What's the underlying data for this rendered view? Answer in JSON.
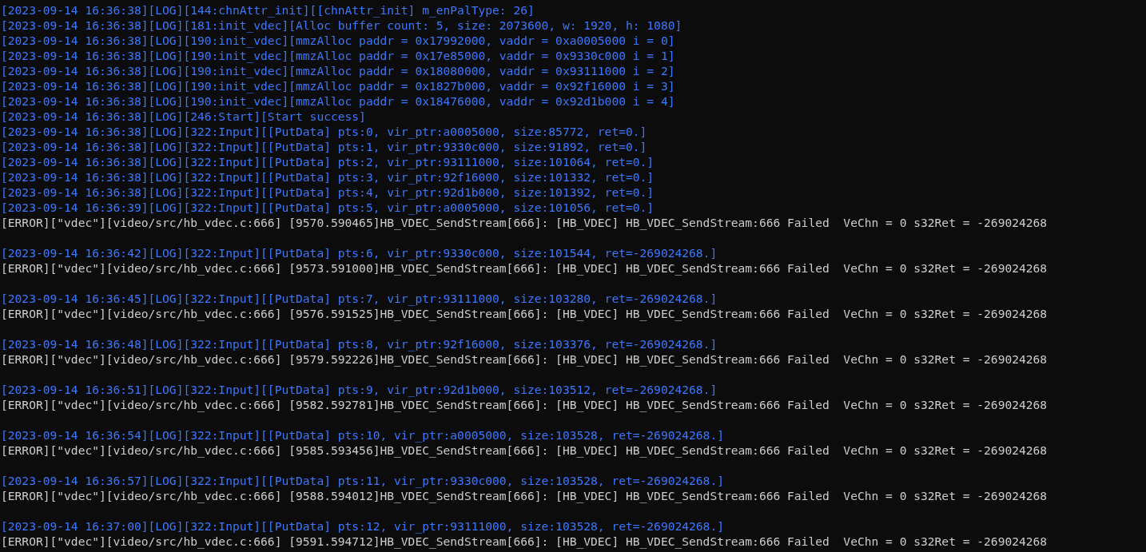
{
  "lines": [
    {
      "kind": "log",
      "text": "[2023-09-14 16:36:38][LOG][144:chnAttr_init][[chnAttr_init] m_enPalType: 26]"
    },
    {
      "kind": "log",
      "text": "[2023-09-14 16:36:38][LOG][181:init_vdec][Alloc buffer count: 5, size: 2073600, w: 1920, h: 1080]"
    },
    {
      "kind": "log",
      "text": "[2023-09-14 16:36:38][LOG][190:init_vdec][mmzAlloc paddr = 0x17992000, vaddr = 0xa0005000 i = 0]"
    },
    {
      "kind": "log",
      "text": "[2023-09-14 16:36:38][LOG][190:init_vdec][mmzAlloc paddr = 0x17e85000, vaddr = 0x9330c000 i = 1]"
    },
    {
      "kind": "log",
      "text": "[2023-09-14 16:36:38][LOG][190:init_vdec][mmzAlloc paddr = 0x18080000, vaddr = 0x93111000 i = 2]"
    },
    {
      "kind": "log",
      "text": "[2023-09-14 16:36:38][LOG][190:init_vdec][mmzAlloc paddr = 0x1827b000, vaddr = 0x92f16000 i = 3]"
    },
    {
      "kind": "log",
      "text": "[2023-09-14 16:36:38][LOG][190:init_vdec][mmzAlloc paddr = 0x18476000, vaddr = 0x92d1b000 i = 4]"
    },
    {
      "kind": "log",
      "text": "[2023-09-14 16:36:38][LOG][246:Start][Start success]"
    },
    {
      "kind": "log",
      "text": "[2023-09-14 16:36:38][LOG][322:Input][[PutData] pts:0, vir_ptr:a0005000, size:85772, ret=0.]"
    },
    {
      "kind": "log",
      "text": "[2023-09-14 16:36:38][LOG][322:Input][[PutData] pts:1, vir_ptr:9330c000, size:91892, ret=0.]"
    },
    {
      "kind": "log",
      "text": "[2023-09-14 16:36:38][LOG][322:Input][[PutData] pts:2, vir_ptr:93111000, size:101064, ret=0.]"
    },
    {
      "kind": "log",
      "text": "[2023-09-14 16:36:38][LOG][322:Input][[PutData] pts:3, vir_ptr:92f16000, size:101332, ret=0.]"
    },
    {
      "kind": "log",
      "text": "[2023-09-14 16:36:38][LOG][322:Input][[PutData] pts:4, vir_ptr:92d1b000, size:101392, ret=0.]"
    },
    {
      "kind": "log",
      "text": "[2023-09-14 16:36:39][LOG][322:Input][[PutData] pts:5, vir_ptr:a0005000, size:101056, ret=0.]"
    },
    {
      "kind": "error",
      "text": "[ERROR][\"vdec\"][video/src/hb_vdec.c:666] [9570.590465]HB_VDEC_SendStream[666]: [HB_VDEC] HB_VDEC_SendStream:666 Failed  VeChn = 0 s32Ret = -269024268"
    },
    {
      "kind": "blank"
    },
    {
      "kind": "log",
      "text": "[2023-09-14 16:36:42][LOG][322:Input][[PutData] pts:6, vir_ptr:9330c000, size:101544, ret=-269024268.]"
    },
    {
      "kind": "error",
      "text": "[ERROR][\"vdec\"][video/src/hb_vdec.c:666] [9573.591000]HB_VDEC_SendStream[666]: [HB_VDEC] HB_VDEC_SendStream:666 Failed  VeChn = 0 s32Ret = -269024268"
    },
    {
      "kind": "blank"
    },
    {
      "kind": "log",
      "text": "[2023-09-14 16:36:45][LOG][322:Input][[PutData] pts:7, vir_ptr:93111000, size:103280, ret=-269024268.]"
    },
    {
      "kind": "error",
      "text": "[ERROR][\"vdec\"][video/src/hb_vdec.c:666] [9576.591525]HB_VDEC_SendStream[666]: [HB_VDEC] HB_VDEC_SendStream:666 Failed  VeChn = 0 s32Ret = -269024268"
    },
    {
      "kind": "blank"
    },
    {
      "kind": "log",
      "text": "[2023-09-14 16:36:48][LOG][322:Input][[PutData] pts:8, vir_ptr:92f16000, size:103376, ret=-269024268.]"
    },
    {
      "kind": "error",
      "text": "[ERROR][\"vdec\"][video/src/hb_vdec.c:666] [9579.592226]HB_VDEC_SendStream[666]: [HB_VDEC] HB_VDEC_SendStream:666 Failed  VeChn = 0 s32Ret = -269024268"
    },
    {
      "kind": "blank"
    },
    {
      "kind": "log",
      "text": "[2023-09-14 16:36:51][LOG][322:Input][[PutData] pts:9, vir_ptr:92d1b000, size:103512, ret=-269024268.]"
    },
    {
      "kind": "error",
      "text": "[ERROR][\"vdec\"][video/src/hb_vdec.c:666] [9582.592781]HB_VDEC_SendStream[666]: [HB_VDEC] HB_VDEC_SendStream:666 Failed  VeChn = 0 s32Ret = -269024268"
    },
    {
      "kind": "blank"
    },
    {
      "kind": "log",
      "text": "[2023-09-14 16:36:54][LOG][322:Input][[PutData] pts:10, vir_ptr:a0005000, size:103528, ret=-269024268.]"
    },
    {
      "kind": "error",
      "text": "[ERROR][\"vdec\"][video/src/hb_vdec.c:666] [9585.593456]HB_VDEC_SendStream[666]: [HB_VDEC] HB_VDEC_SendStream:666 Failed  VeChn = 0 s32Ret = -269024268"
    },
    {
      "kind": "blank"
    },
    {
      "kind": "log",
      "text": "[2023-09-14 16:36:57][LOG][322:Input][[PutData] pts:11, vir_ptr:9330c000, size:103528, ret=-269024268.]"
    },
    {
      "kind": "error",
      "text": "[ERROR][\"vdec\"][video/src/hb_vdec.c:666] [9588.594012]HB_VDEC_SendStream[666]: [HB_VDEC] HB_VDEC_SendStream:666 Failed  VeChn = 0 s32Ret = -269024268"
    },
    {
      "kind": "blank"
    },
    {
      "kind": "log",
      "text": "[2023-09-14 16:37:00][LOG][322:Input][[PutData] pts:12, vir_ptr:93111000, size:103528, ret=-269024268.]"
    },
    {
      "kind": "error",
      "text": "[ERROR][\"vdec\"][video/src/hb_vdec.c:666] [9591.594712]HB_VDEC_SendStream[666]: [HB_VDEC] HB_VDEC_SendStream:666 Failed  VeChn = 0 s32Ret = -269024268"
    }
  ]
}
